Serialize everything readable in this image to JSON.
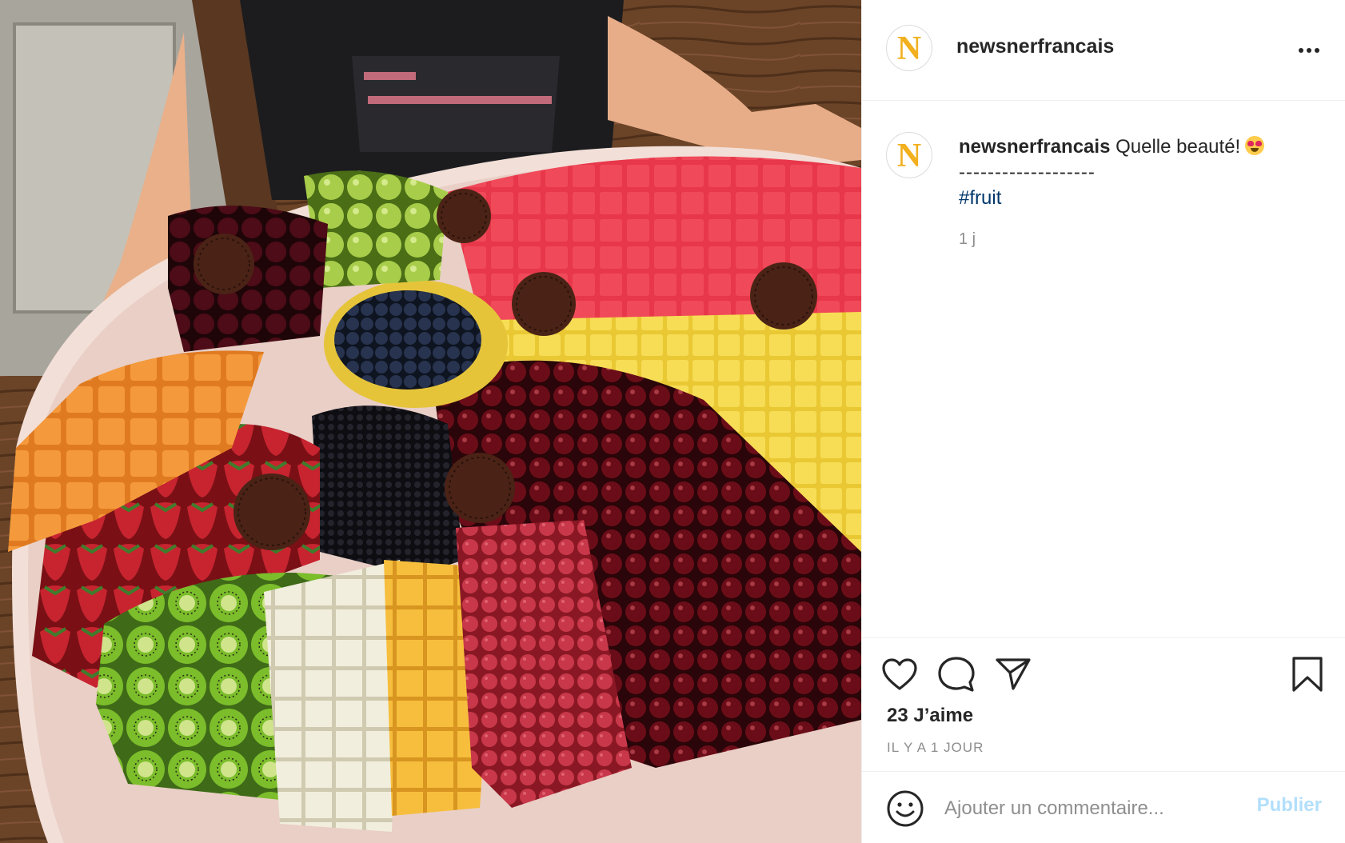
{
  "post": {
    "account": "newsnerfrancais",
    "avatar_letter": "N",
    "image_alt": "",
    "caption": {
      "text": "Quelle beauté!",
      "emoji": "smiling-face-with-heart-eyes",
      "separator": "-------------------",
      "hashtag": "#fruit"
    },
    "time_short": "1 j",
    "likes": "23 J’aime",
    "posted": "IL Y A 1 JOUR"
  },
  "comment": {
    "placeholder": "Ajouter un commentaire...",
    "publish_label": "Publier"
  },
  "icons": {
    "more": "more-options-icon",
    "like": "heart-icon",
    "comment": "comment-bubble-icon",
    "share": "paper-plane-icon",
    "save": "bookmark-icon",
    "emoji": "smiley-icon"
  },
  "colors": {
    "brand_letter": "#f2b01e",
    "hashtag": "#00376b",
    "muted_text": "#8e8e8e",
    "publish_disabled": "#b2dffc",
    "border": "#efefef"
  }
}
